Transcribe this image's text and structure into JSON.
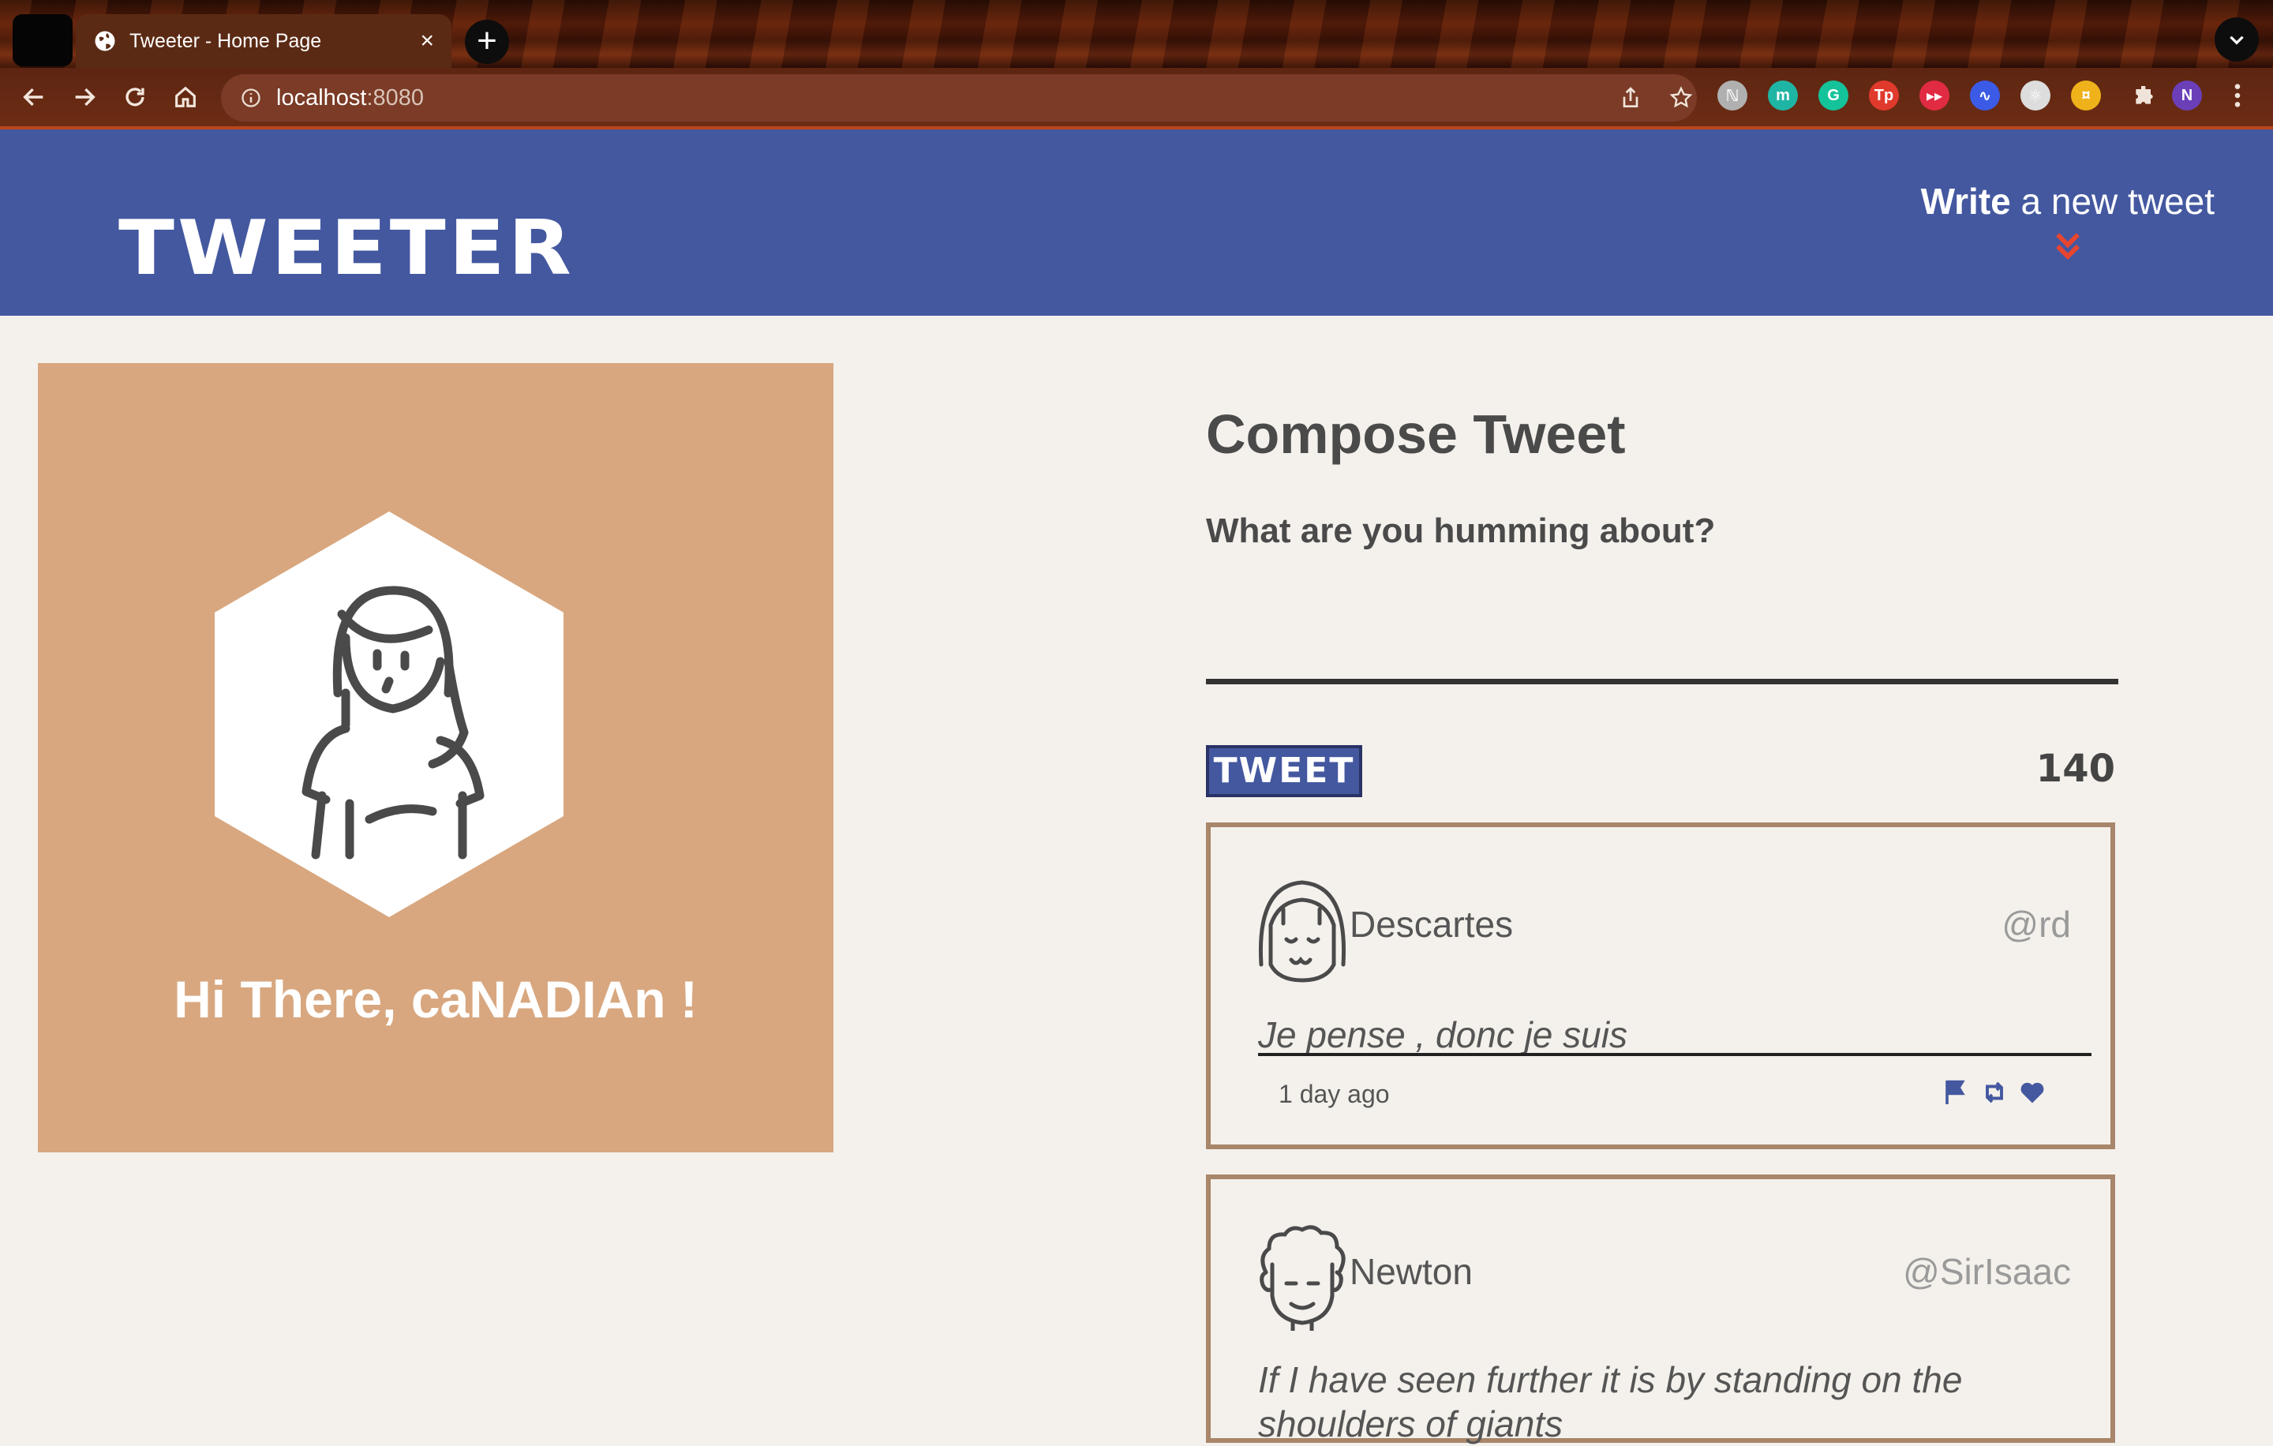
{
  "browser": {
    "tab_title": "Tweeter - Home Page",
    "tab_close": "×",
    "new_tab": "+",
    "url_host": "localhost",
    "url_port": ":8080",
    "profile_initial": "N",
    "extensions": [
      {
        "name": "notion-ext",
        "color": "#b0b0b0",
        "glyph": "ℕ"
      },
      {
        "name": "m-ext",
        "color": "#1fb5a4",
        "glyph": "m"
      },
      {
        "name": "grammarly-ext",
        "color": "#15c39a",
        "glyph": "G"
      },
      {
        "name": "tp-ext",
        "color": "#e03a2d",
        "glyph": "Tp"
      },
      {
        "name": "video-ext",
        "color": "#e02b42",
        "glyph": "▸▸"
      },
      {
        "name": "wave-ext",
        "color": "#3b5be6",
        "glyph": "∿"
      },
      {
        "name": "react-ext",
        "color": "#dddddd",
        "glyph": "⚛"
      },
      {
        "name": "coin-ext",
        "color": "#f0b21a",
        "glyph": "¤"
      }
    ]
  },
  "header": {
    "brand": "TWEETER",
    "write_bold": "Write",
    "write_rest": " a new tweet"
  },
  "profile": {
    "greeting": "Hi There, caNADIAn !"
  },
  "compose": {
    "title": "Compose Tweet",
    "prompt": "What are you humming about?",
    "textarea_value": "",
    "button_label": "TWEET",
    "counter": "140"
  },
  "tweets": [
    {
      "name": "Descartes",
      "handle": "@rd",
      "text": "Je pense , donc je suis",
      "time": "1 day ago"
    },
    {
      "name": "Newton",
      "handle": "@SirIsaac",
      "text": "If I have seen further it is by standing on the shoulders of giants"
    }
  ],
  "colors": {
    "header_bg": "#4458a0",
    "profile_bg": "#d8a77f",
    "page_bg": "#f4f1ec",
    "chevron": "#e8452f",
    "tweet_border": "#a8866a"
  }
}
